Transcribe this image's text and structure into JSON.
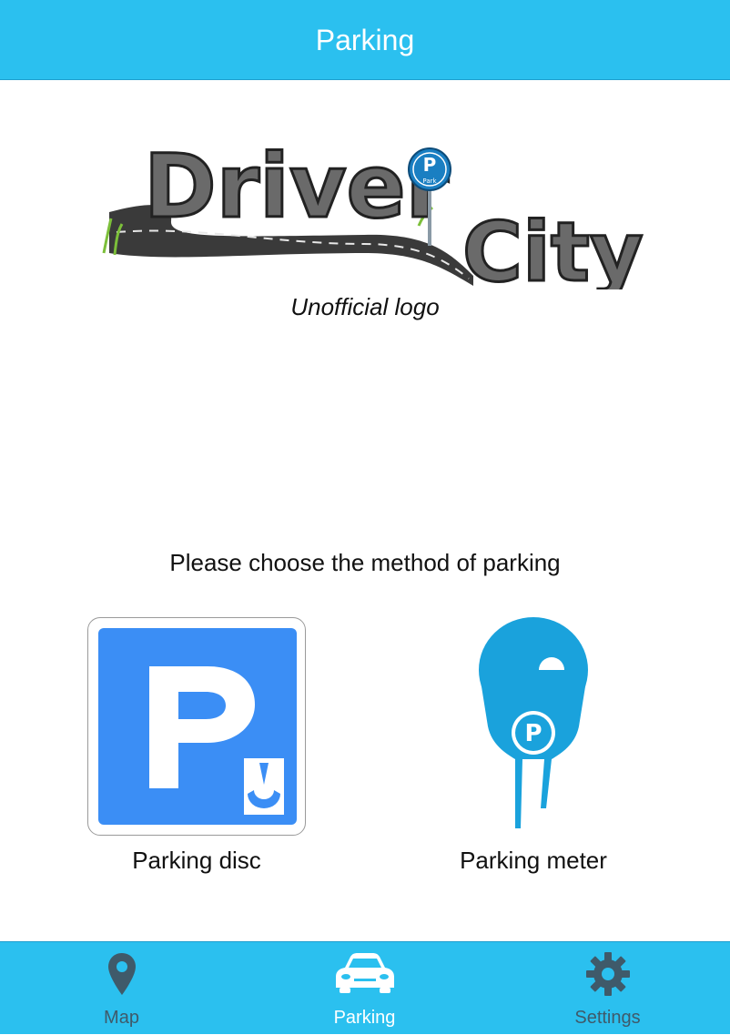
{
  "header": {
    "title": "Parking"
  },
  "logo": {
    "word1": "Driver",
    "word2": "City",
    "sign_letter": "P",
    "sign_text": "Park",
    "caption": "Unofficial logo"
  },
  "prompt": "Please choose the method of parking",
  "options": [
    {
      "label": "Parking disc",
      "icon": "parking-disc-icon"
    },
    {
      "label": "Parking meter",
      "icon": "parking-meter-icon"
    }
  ],
  "tabs": [
    {
      "label": "Map",
      "icon": "map-pin-icon",
      "selected": false
    },
    {
      "label": "Parking",
      "icon": "car-icon",
      "selected": true
    },
    {
      "label": "Settings",
      "icon": "gear-icon",
      "selected": false
    }
  ],
  "colors": {
    "bar": "#2bc0ef",
    "disc_blue": "#3b8ef5",
    "meter_blue": "#1aa2dc",
    "tab_inactive": "#3f5a6a",
    "tab_active": "#ffffff"
  }
}
